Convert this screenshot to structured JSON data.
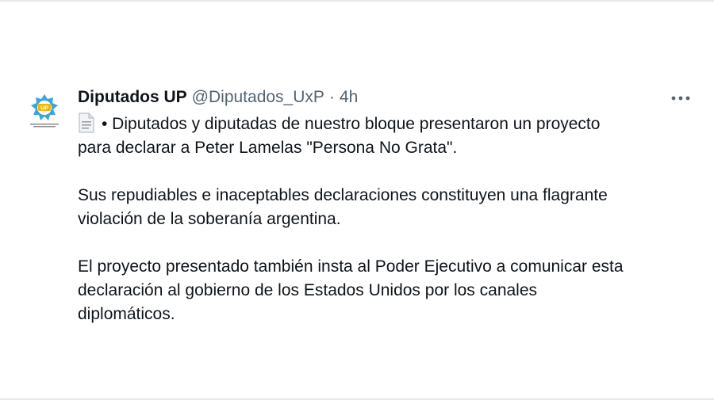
{
  "tweet": {
    "display_name": "Diputados UP",
    "handle": "@Diputados_UxP",
    "separator": "·",
    "time": "4h",
    "avatar": {
      "name": "up-logo-icon",
      "badge_text": "UP",
      "color": "#3ba5e0",
      "badge_color": "#f5b400"
    },
    "more_icon": "more-horizontal-icon",
    "lead_icon": "document-icon",
    "paragraphs": [
      {
        "lines": [
          "• Diputados y diputadas de nuestro bloque presentaron un proyecto",
          "para declarar a Peter Lamelas \"Persona No Grata\"."
        ]
      },
      {
        "lines": [
          "Sus repudiables e inaceptables declaraciones constituyen una flagrante",
          "violación de la soberanía argentina."
        ]
      },
      {
        "lines": [
          "El proyecto presentado también insta al Poder Ejecutivo a comunicar esta",
          "declaración al gobierno de los Estados Unidos por los canales",
          "diplomáticos."
        ]
      }
    ]
  },
  "colors": {
    "text": "#0f1419",
    "secondary": "#536471",
    "divider": "#e7e9ea"
  }
}
